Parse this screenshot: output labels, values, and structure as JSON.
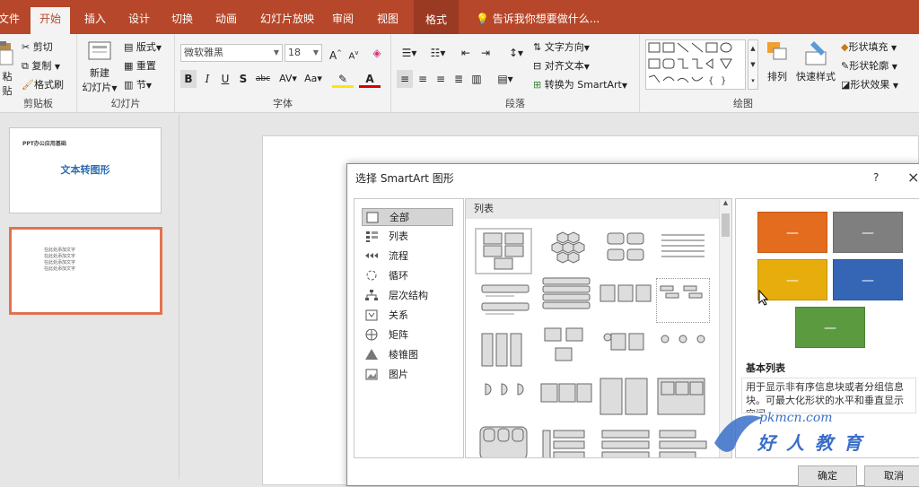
{
  "tabs": [
    "文件",
    "开始",
    "插入",
    "设计",
    "切换",
    "动画",
    "幻灯片放映",
    "审阅",
    "视图",
    "格式"
  ],
  "tell_me": "告诉我你想要做什么...",
  "ribbon": {
    "clipboard": {
      "paste": "粘贴",
      "cut": "剪切",
      "copy": "复制",
      "format_painter": "格式刷",
      "label": "剪贴板"
    },
    "slides": {
      "new_slide": "新建",
      "new_slide2": "幻灯片",
      "layout": "版式",
      "reset": "重置",
      "section": "节",
      "label": "幻灯片"
    },
    "font": {
      "family": "微软雅黑",
      "size": "18",
      "label": "字体"
    },
    "paragraph": {
      "text_direction": "文字方向",
      "align_text": "对齐文本",
      "convert_smartart": "转换为 SmartArt",
      "label": "段落"
    },
    "drawing": {
      "arrange": "排列",
      "quick_styles": "快速样式",
      "shape_fill": "形状填充",
      "shape_outline": "形状轮廓",
      "shape_effects": "形状效果",
      "label": "绘图"
    }
  },
  "slides": [
    {
      "small_title": "PPT办公应用基础",
      "title": "文本转图形"
    },
    {
      "lines": [
        "在此处添加文字",
        "在此处添加文字",
        "在此处添加文字",
        "在此处添加文字"
      ]
    }
  ],
  "dialog": {
    "title": "选择 SmartArt 图形",
    "help": "?",
    "close": "×",
    "categories": [
      "全部",
      "列表",
      "流程",
      "循环",
      "层次结构",
      "关系",
      "矩阵",
      "棱锥图",
      "图片"
    ],
    "gallery_header": "列表",
    "preview_title": "基本列表",
    "preview_desc": "用于显示非有序信息块或者分组信息块。可最大化形状的水平和垂直显示空间。",
    "ok": "确定",
    "cancel": "取消",
    "preview_colors": [
      "#e46c1e",
      "#7f7f7f",
      "#e6ad0c",
      "#3565b5",
      "#5b9a3e"
    ]
  },
  "watermark": {
    "url": "pkmcn.com",
    "brand": "好人教育"
  }
}
